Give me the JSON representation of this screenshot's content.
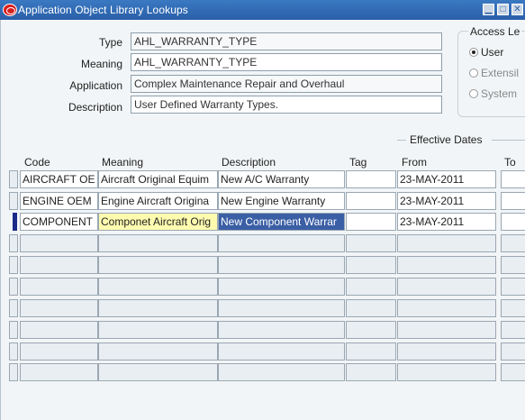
{
  "window": {
    "title": "Application Object Library Lookups",
    "buttons": {
      "minimize": "▁",
      "maximize": "□",
      "close": "✕"
    }
  },
  "header": {
    "type": {
      "label": "Type",
      "value": "AHL_WARRANTY_TYPE"
    },
    "meaning": {
      "label": "Meaning",
      "value": "AHL_WARRANTY_TYPE"
    },
    "application": {
      "label": "Application",
      "value": "Complex Maintenance Repair and Overhaul"
    },
    "description": {
      "label": "Description",
      "value": "User Defined Warranty Types."
    }
  },
  "access_level": {
    "title": "Access Le",
    "options": [
      {
        "label": "User",
        "selected": true
      },
      {
        "label": "Extensil",
        "selected": false
      },
      {
        "label": "System",
        "selected": false
      }
    ]
  },
  "effective_dates_title": "Effective Dates",
  "grid": {
    "columns": {
      "code": "Code",
      "meaning": "Meaning",
      "description": "Description",
      "tag": "Tag",
      "from": "From",
      "to": "To"
    },
    "rows": [
      {
        "code": "AIRCRAFT OE",
        "meaning": "Aircraft Original Equim",
        "description": "New A/C Warranty",
        "tag": "",
        "from": "23-MAY-2011",
        "to": ""
      },
      {
        "code": "ENGINE OEM",
        "meaning": "Engine Aircraft Origina",
        "description": "New Engine Warranty",
        "tag": "",
        "from": "23-MAY-2011",
        "to": ""
      },
      {
        "code": "COMPONENT",
        "meaning": "Componet Aircraft Orig",
        "description": "New Component Warrar",
        "tag": "",
        "from": "23-MAY-2011",
        "to": ""
      }
    ]
  },
  "colors": {
    "title_bar": "#2a5fa8",
    "current_row_indicator": "#1a2a88",
    "highlight_yellow": "#fffcb0",
    "highlight_blue": "#3b5fa5"
  }
}
